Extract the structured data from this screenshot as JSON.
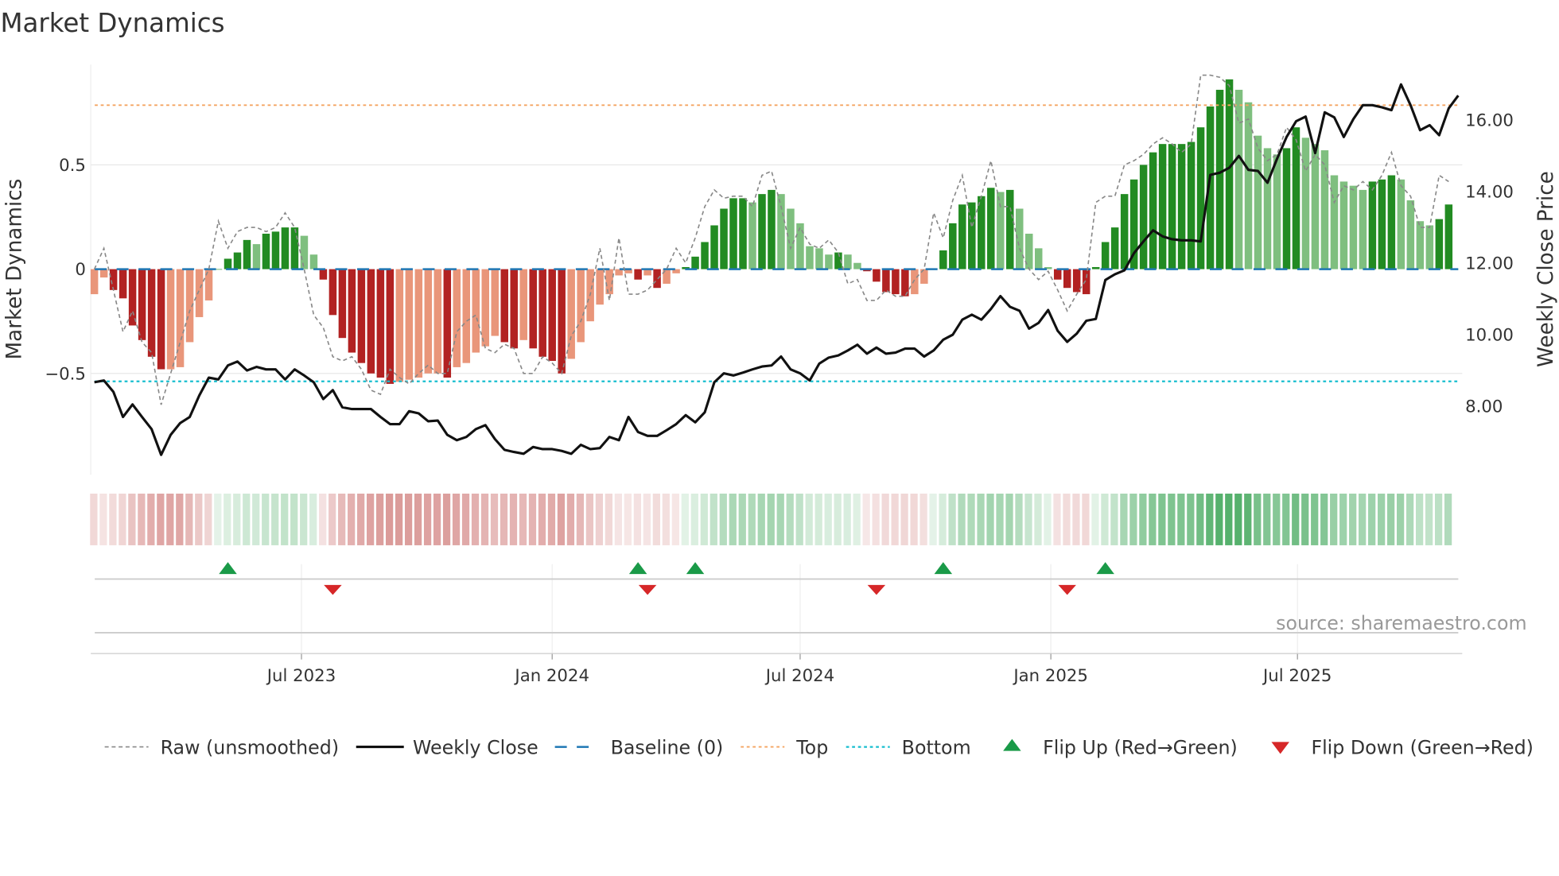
{
  "chart_data": {
    "type": "bar",
    "title": "Market Dynamics",
    "ylabel_left": "Market Dynamics",
    "ylabel_right": "Weekly Close Price",
    "source": "source: sharemaestro.com",
    "start_date": "2023-01-30",
    "step_days": 7,
    "left_ylim": [
      -0.98,
      0.98
    ],
    "right_ylim": [
      6.2,
      17.6
    ],
    "left_ticks": [
      {
        "v": 0.5,
        "label": "0.5"
      },
      {
        "v": 0,
        "label": "0"
      },
      {
        "v": -0.5,
        "label": "−0.5"
      }
    ],
    "right_ticks": [
      {
        "v": 16,
        "label": "16.00"
      },
      {
        "v": 14,
        "label": "14.00"
      },
      {
        "v": 12,
        "label": "12.00"
      },
      {
        "v": 10,
        "label": "10.00"
      },
      {
        "v": 8,
        "label": "8.00"
      }
    ],
    "x_ticks": [
      {
        "date": "2023-07-01",
        "label": "Jul 2023"
      },
      {
        "date": "2024-01-01",
        "label": "Jan 2024"
      },
      {
        "date": "2024-07-01",
        "label": "Jul 2024"
      },
      {
        "date": "2025-01-01",
        "label": "Jan 2025"
      },
      {
        "date": "2025-07-01",
        "label": "Jul 2025"
      }
    ],
    "top_level": 0.786,
    "bottom_level": -0.538,
    "baseline": 0,
    "smoothed": [
      -0.12,
      -0.04,
      -0.1,
      -0.14,
      -0.27,
      -0.34,
      -0.42,
      -0.48,
      -0.48,
      -0.47,
      -0.35,
      -0.23,
      -0.15,
      0.0,
      0.05,
      0.08,
      0.14,
      0.12,
      0.17,
      0.18,
      0.2,
      0.2,
      0.16,
      0.07,
      -0.05,
      -0.22,
      -0.33,
      -0.4,
      -0.45,
      -0.5,
      -0.52,
      -0.55,
      -0.54,
      -0.53,
      -0.52,
      -0.5,
      -0.5,
      -0.52,
      -0.47,
      -0.45,
      -0.4,
      -0.37,
      -0.32,
      -0.35,
      -0.38,
      -0.34,
      -0.38,
      -0.42,
      -0.44,
      -0.5,
      -0.43,
      -0.35,
      -0.25,
      -0.17,
      -0.12,
      -0.03,
      -0.02,
      -0.05,
      -0.03,
      -0.09,
      -0.07,
      -0.02,
      0.01,
      0.06,
      0.13,
      0.21,
      0.29,
      0.34,
      0.34,
      0.32,
      0.36,
      0.38,
      0.36,
      0.29,
      0.22,
      0.11,
      0.1,
      0.07,
      0.08,
      0.07,
      0.03,
      -0.01,
      -0.06,
      -0.11,
      -0.12,
      -0.13,
      -0.12,
      -0.07,
      0.0,
      0.09,
      0.22,
      0.31,
      0.32,
      0.35,
      0.39,
      0.37,
      0.38,
      0.29,
      0.17,
      0.1,
      0.01,
      -0.05,
      -0.09,
      -0.11,
      -0.12,
      0.01,
      0.13,
      0.2,
      0.36,
      0.43,
      0.5,
      0.56,
      0.6,
      0.6,
      0.6,
      0.61,
      0.68,
      0.78,
      0.86,
      0.91,
      0.86,
      0.8,
      0.64,
      0.58,
      0.55,
      0.58,
      0.68,
      0.63,
      0.6,
      0.57,
      0.45,
      0.42,
      0.4,
      0.38,
      0.42,
      0.43,
      0.45,
      0.43,
      0.33,
      0.23,
      0.21,
      0.24,
      0.31
    ],
    "raw": [
      0.0,
      0.1,
      -0.1,
      -0.3,
      -0.2,
      -0.35,
      -0.4,
      -0.65,
      -0.5,
      -0.35,
      -0.2,
      -0.1,
      0.0,
      0.23,
      0.1,
      0.18,
      0.2,
      0.2,
      0.18,
      0.2,
      0.27,
      0.2,
      0.0,
      -0.22,
      -0.28,
      -0.42,
      -0.44,
      -0.42,
      -0.48,
      -0.58,
      -0.6,
      -0.48,
      -0.52,
      -0.55,
      -0.5,
      -0.46,
      -0.5,
      -0.5,
      -0.3,
      -0.25,
      -0.22,
      -0.38,
      -0.4,
      -0.36,
      -0.38,
      -0.5,
      -0.5,
      -0.42,
      -0.45,
      -0.5,
      -0.32,
      -0.25,
      -0.12,
      0.1,
      -0.15,
      0.15,
      -0.12,
      -0.12,
      -0.1,
      -0.05,
      0.0,
      0.1,
      0.03,
      0.15,
      0.3,
      0.38,
      0.34,
      0.35,
      0.35,
      0.3,
      0.45,
      0.47,
      0.3,
      0.1,
      0.2,
      0.12,
      0.1,
      0.14,
      0.08,
      -0.07,
      -0.05,
      -0.15,
      -0.15,
      -0.1,
      -0.13,
      -0.13,
      -0.05,
      0.0,
      0.27,
      0.15,
      0.33,
      0.45,
      0.2,
      0.35,
      0.52,
      0.3,
      0.3,
      0.1,
      0.0,
      -0.05,
      -0.01,
      -0.1,
      -0.2,
      -0.12,
      -0.05,
      0.32,
      0.35,
      0.35,
      0.5,
      0.52,
      0.55,
      0.6,
      0.63,
      0.6,
      0.56,
      0.6,
      0.93,
      0.93,
      0.92,
      0.88,
      0.7,
      0.72,
      0.58,
      0.52,
      0.55,
      0.68,
      0.62,
      0.47,
      0.55,
      0.5,
      0.32,
      0.4,
      0.38,
      0.42,
      0.38,
      0.45,
      0.56,
      0.4,
      0.35,
      0.2,
      0.2,
      0.45,
      0.42
    ],
    "close": [
      8.67,
      8.72,
      8.4,
      7.7,
      8.05,
      7.7,
      7.36,
      6.64,
      7.2,
      7.53,
      7.7,
      8.3,
      8.8,
      8.75,
      9.14,
      9.25,
      9.0,
      9.1,
      9.03,
      9.03,
      8.75,
      9.03,
      8.86,
      8.67,
      8.2,
      8.45,
      7.97,
      7.92,
      7.92,
      7.92,
      7.7,
      7.5,
      7.5,
      7.86,
      7.8,
      7.58,
      7.6,
      7.2,
      7.05,
      7.14,
      7.36,
      7.47,
      7.08,
      6.78,
      6.72,
      6.67,
      6.86,
      6.8,
      6.8,
      6.75,
      6.67,
      6.92,
      6.8,
      6.83,
      7.14,
      7.05,
      7.7,
      7.28,
      7.17,
      7.17,
      7.33,
      7.5,
      7.75,
      7.55,
      7.83,
      8.67,
      8.92,
      8.86,
      8.94,
      9.03,
      9.11,
      9.14,
      9.39,
      9.03,
      8.92,
      8.72,
      9.19,
      9.36,
      9.42,
      9.56,
      9.72,
      9.47,
      9.64,
      9.47,
      9.5,
      9.61,
      9.61,
      9.39,
      9.56,
      9.86,
      10.0,
      10.42,
      10.56,
      10.42,
      10.72,
      11.08,
      10.78,
      10.67,
      10.17,
      10.33,
      10.69,
      10.11,
      9.8,
      10.03,
      10.39,
      10.44,
      11.53,
      11.69,
      11.8,
      12.28,
      12.61,
      12.92,
      12.75,
      12.67,
      12.64,
      12.64,
      12.61,
      14.47,
      14.53,
      14.67,
      15.0,
      14.61,
      14.58,
      14.25,
      14.92,
      15.53,
      15.97,
      16.1,
      15.08,
      16.22,
      16.08,
      15.53,
      16.03,
      16.42,
      16.42,
      16.36,
      16.28,
      17.0,
      16.42,
      15.72,
      15.86,
      15.58,
      16.33,
      16.69
    ],
    "flip_up": [
      "2023-05-08",
      "2024-03-04",
      "2024-04-15",
      "2024-10-14",
      "2025-02-10"
    ],
    "flip_down": [
      "2023-07-24",
      "2024-03-11",
      "2024-08-26",
      "2025-01-13"
    ],
    "legend": [
      {
        "key": "raw",
        "label": "Raw (unsmoothed)"
      },
      {
        "key": "close",
        "label": "Weekly Close"
      },
      {
        "key": "baseline",
        "label": "Baseline (0)"
      },
      {
        "key": "top",
        "label": "Top"
      },
      {
        "key": "bottom",
        "label": "Bottom"
      },
      {
        "key": "flip_up",
        "label": "Flip Up (Red→Green)"
      },
      {
        "key": "flip_down",
        "label": "Flip Down (Green→Red)"
      }
    ],
    "colors": {
      "green_rising": "#228b22",
      "green_falling": "#7fbf7f",
      "red_falling": "#b22222",
      "red_rising": "#e9967a",
      "top": "#f4a460",
      "bottom": "#17becf",
      "baseline": "#1f77b4",
      "flip_up": "#1a9a48",
      "flip_down": "#d62728"
    }
  }
}
